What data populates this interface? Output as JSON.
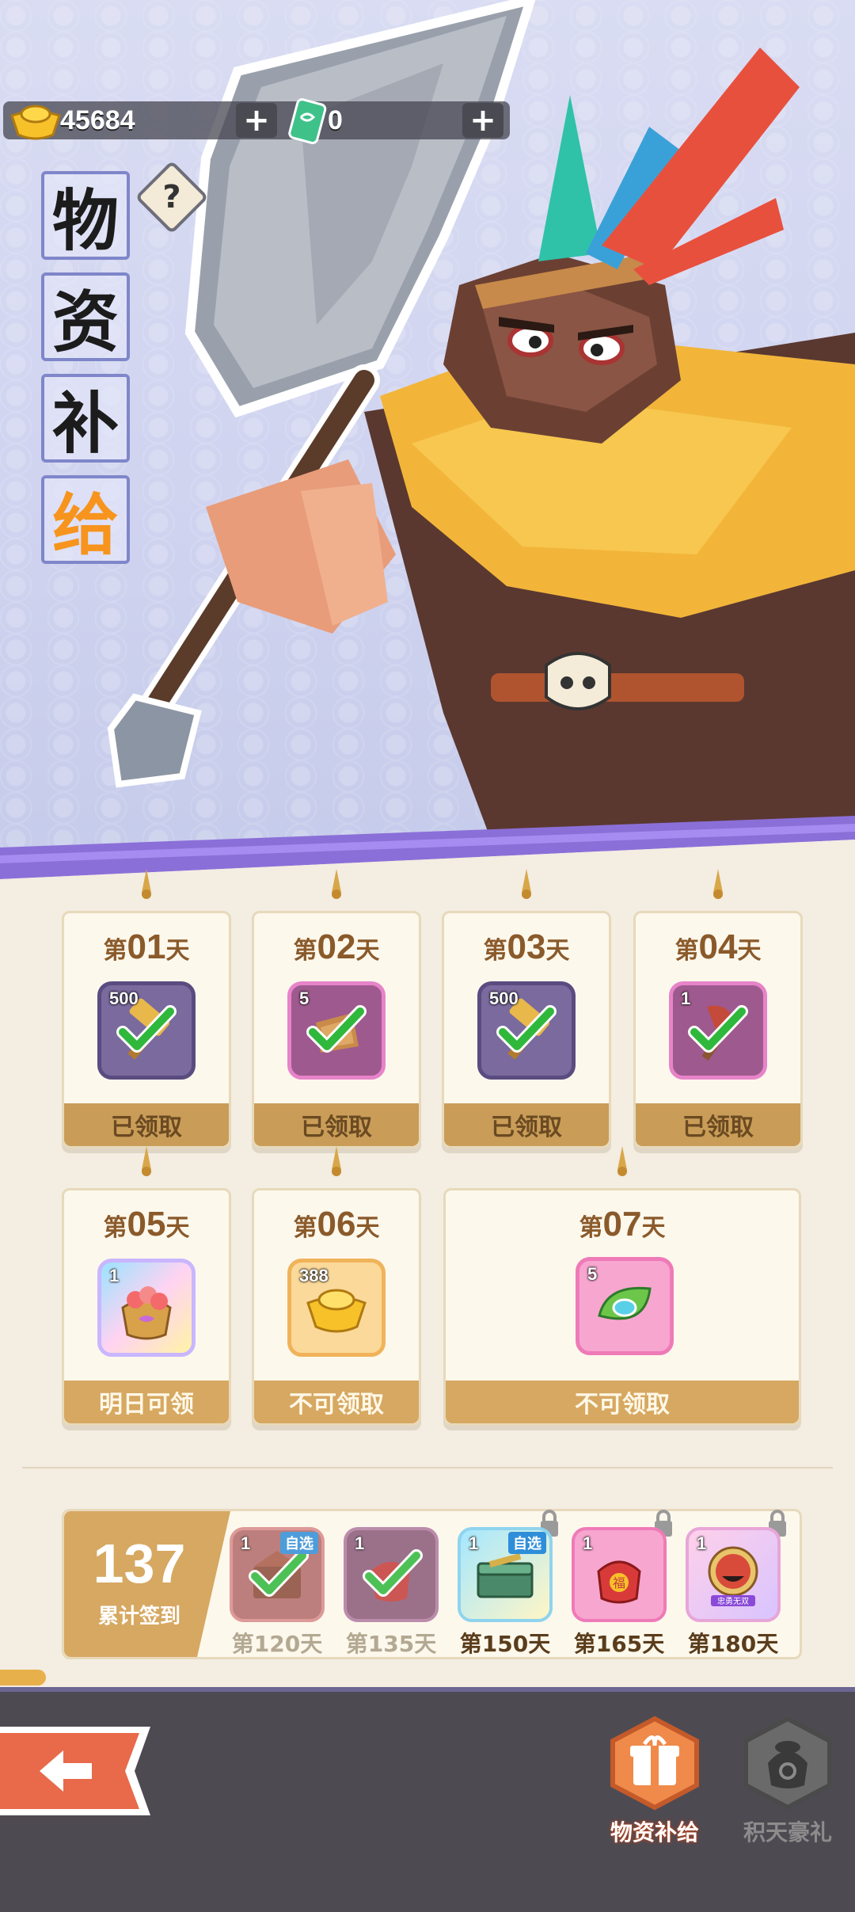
{
  "currency": {
    "gold": "45684",
    "ticket": "0",
    "plus_symbol": "+"
  },
  "title": [
    "物",
    "资",
    "补",
    "给"
  ],
  "help_symbol": "?",
  "day_prefix": "第",
  "day_suffix": "天",
  "days": [
    {
      "num": "01",
      "count": "500",
      "status": "已领取",
      "claimed": true,
      "icon": "golden-hammer-icon"
    },
    {
      "num": "02",
      "count": "5",
      "status": "已领取",
      "claimed": true,
      "icon": "scroll-bundle-icon"
    },
    {
      "num": "03",
      "count": "500",
      "status": "已领取",
      "claimed": true,
      "icon": "golden-hammer-icon"
    },
    {
      "num": "04",
      "count": "1",
      "status": "已领取",
      "claimed": true,
      "icon": "axe-icon"
    },
    {
      "num": "05",
      "count": "1",
      "status": "明日可领",
      "claimed": false,
      "icon": "peach-bag-icon"
    },
    {
      "num": "06",
      "count": "388",
      "status": "不可领取",
      "claimed": false,
      "icon": "gold-ingot-icon"
    },
    {
      "num": "07",
      "count": "5",
      "status": "不可领取",
      "claimed": false,
      "icon": "jade-leaf-icon"
    }
  ],
  "cumulative": {
    "count": "137",
    "label": "累计签到",
    "choose_tag": "自选",
    "items": [
      {
        "day": "第120天",
        "count": "1",
        "done": true,
        "icon": "chest-icon"
      },
      {
        "day": "第135天",
        "count": "1",
        "done": true,
        "icon": "red-pouch-icon"
      },
      {
        "day": "第150天",
        "count": "1",
        "done": false,
        "icon": "treasure-box-icon"
      },
      {
        "day": "第165天",
        "count": "1",
        "done": false,
        "icon": "lucky-bag-icon"
      },
      {
        "day": "第180天",
        "count": "1",
        "done": false,
        "icon": "hero-portrait-icon"
      }
    ],
    "portrait_banner": "忠勇无双",
    "lucky_char": "福"
  },
  "nav": {
    "supply": "物资补给",
    "gift": "积天豪礼"
  },
  "colors": {
    "accent_orange": "#f7941d",
    "card_footer": "#d6a861",
    "purple_band": "#8b6fd8",
    "check_green": "#2fb83c",
    "bottom_bar": "#4e4a52"
  }
}
